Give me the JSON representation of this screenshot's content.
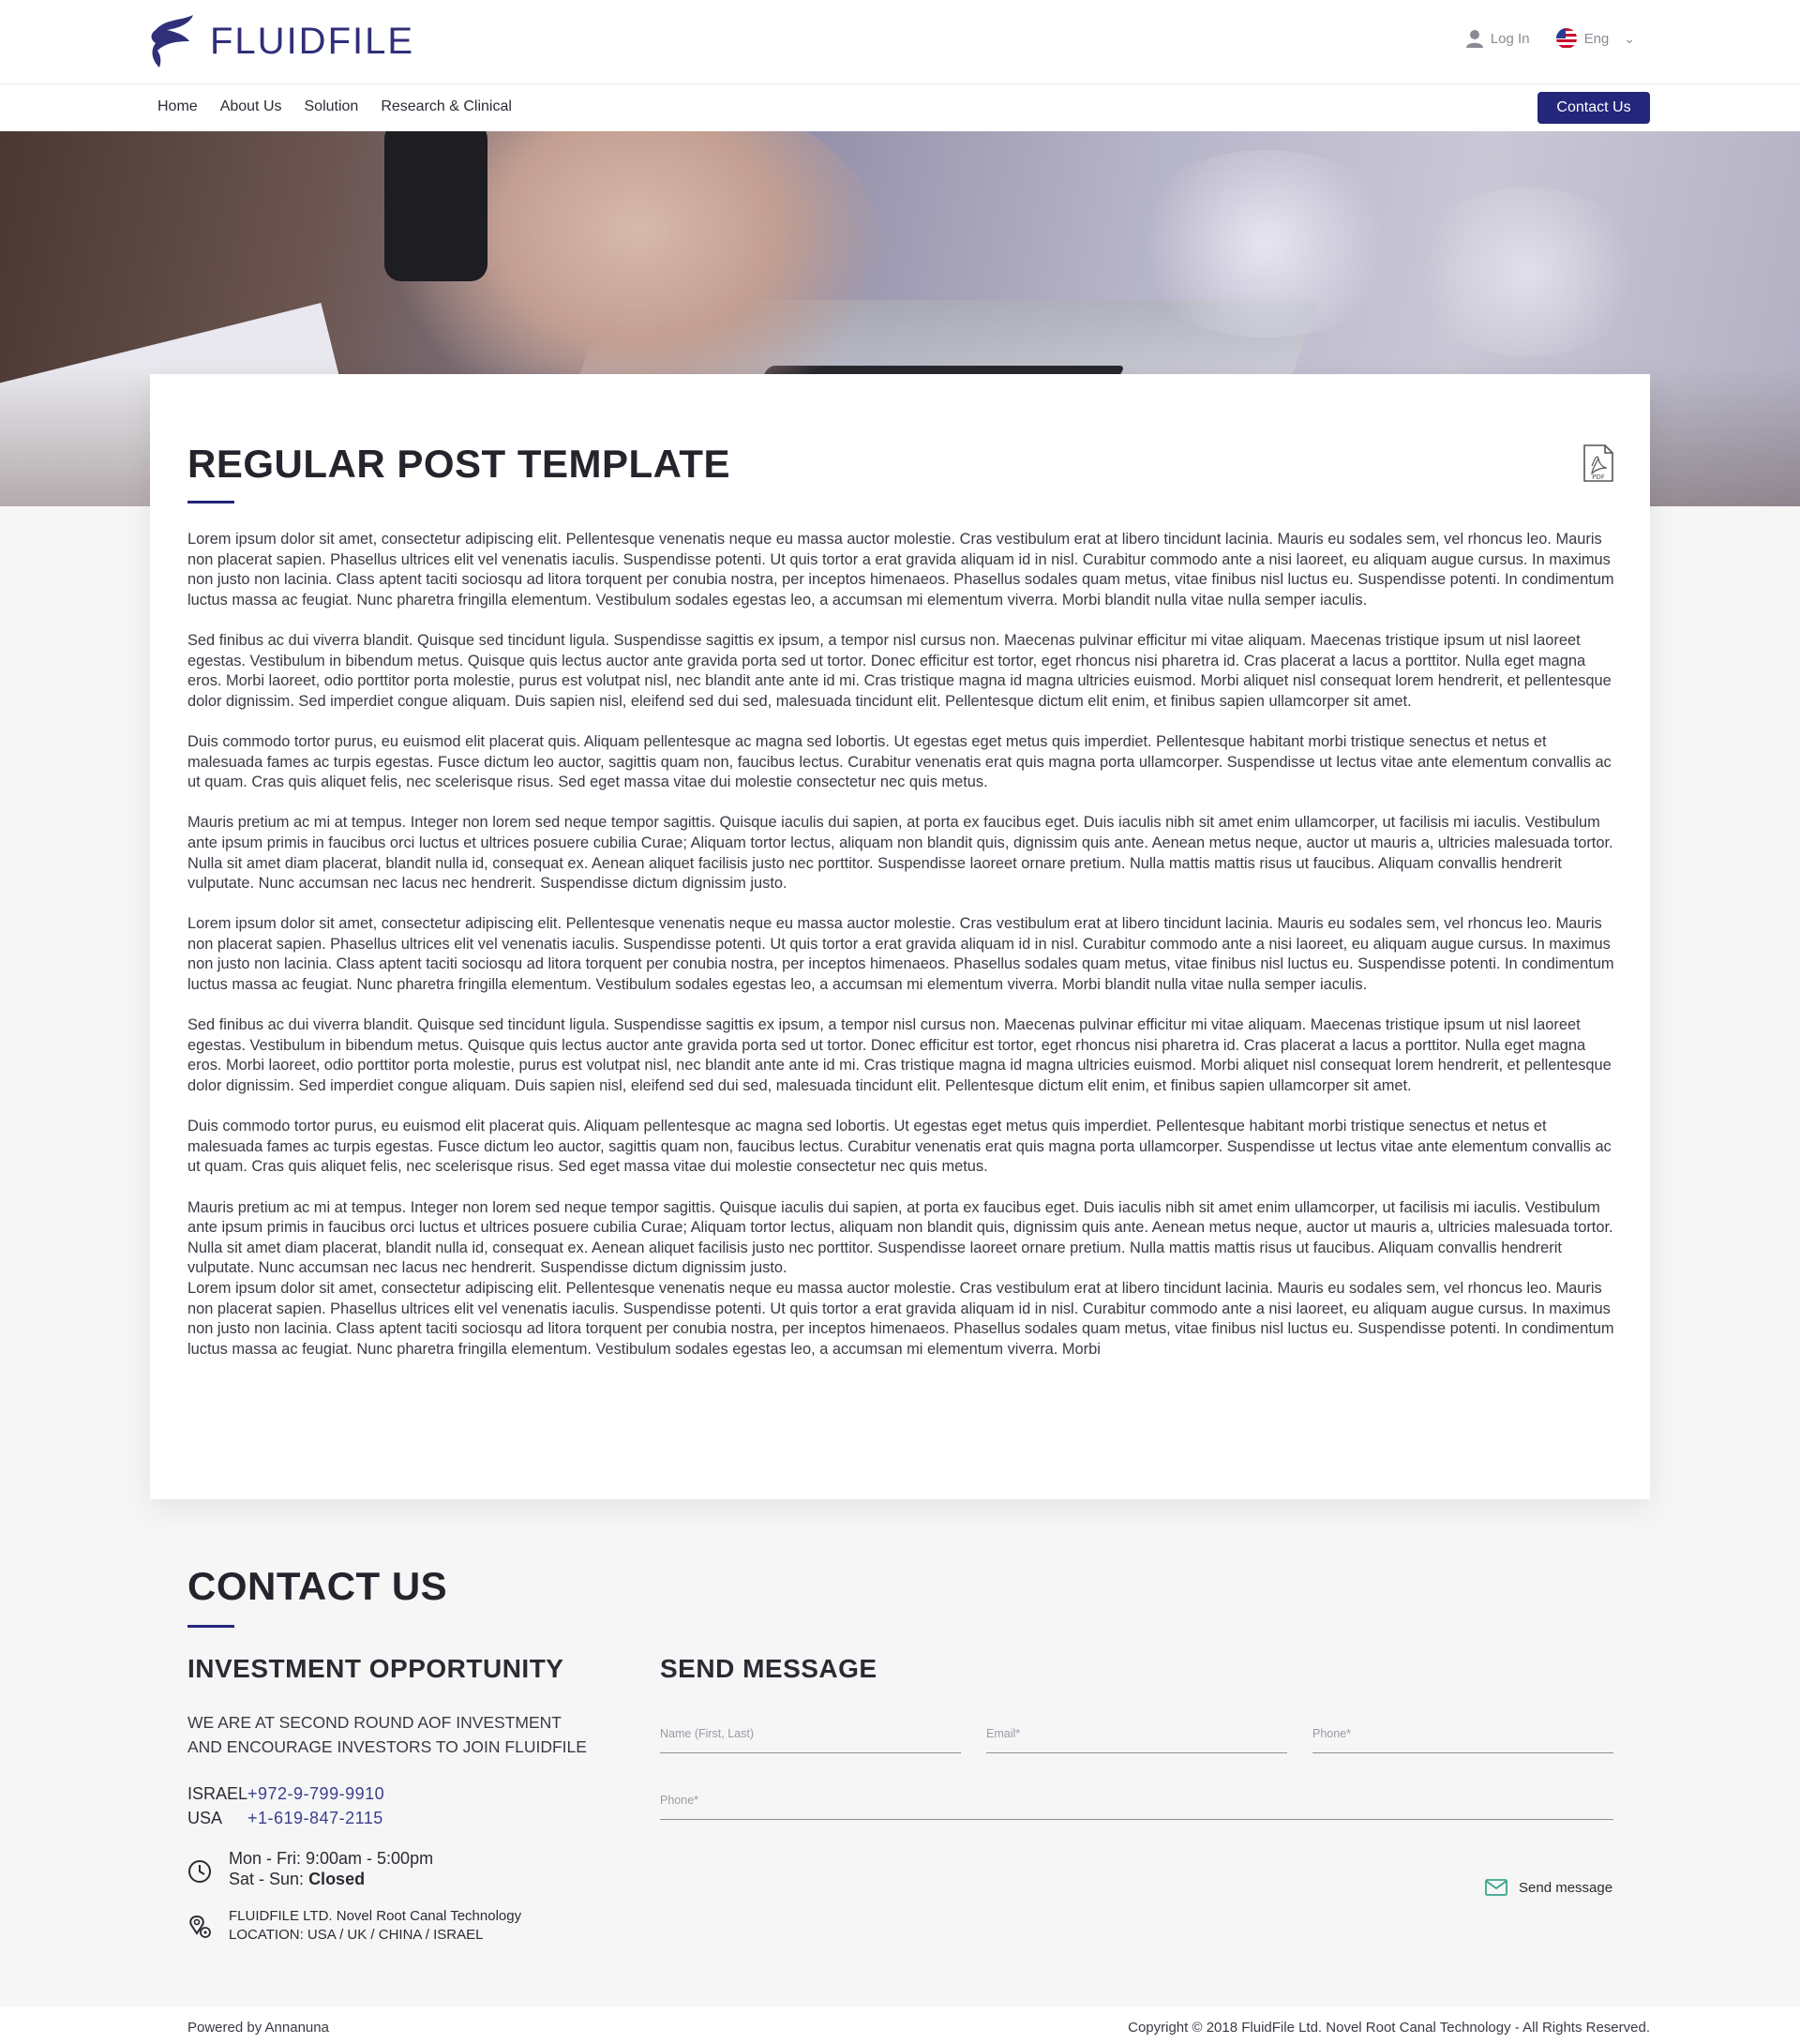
{
  "header": {
    "logo_text": "FLUIDFILE",
    "login_label": "Log In",
    "language_label": "Eng",
    "brand_color": "#23267a"
  },
  "nav": {
    "items": [
      "Home",
      "About Us",
      "Solution",
      "Research & Clinical"
    ],
    "contact_button": "Contact Us"
  },
  "post": {
    "title": "REGULAR POST TEMPLATE",
    "pdf_icon": "pdf-icon",
    "paragraphs": [
      "Lorem ipsum dolor sit amet, consectetur adipiscing elit. Pellentesque venenatis neque eu massa auctor molestie. Cras vestibulum erat at libero tincidunt lacinia. Mauris eu sodales sem, vel rhoncus leo. Mauris non placerat sapien. Phasellus ultrices elit vel venenatis iaculis. Suspendisse potenti. Ut quis tortor a erat gravida aliquam id in nisl. Curabitur commodo ante a nisi laoreet, eu aliquam augue cursus. In maximus non justo non lacinia. Class aptent taciti sociosqu ad litora torquent per conubia nostra, per inceptos himenaeos. Phasellus sodales quam metus, vitae finibus nisl luctus eu. Suspendisse potenti. In condimentum luctus massa ac feugiat. Nunc pharetra fringilla elementum. Vestibulum sodales egestas leo, a accumsan mi elementum viverra. Morbi blandit nulla vitae nulla semper iaculis.",
      "Sed finibus ac dui viverra blandit. Quisque sed tincidunt ligula. Suspendisse sagittis ex ipsum, a tempor nisl cursus non. Maecenas pulvinar efficitur mi vitae aliquam. Maecenas tristique ipsum ut nisl laoreet egestas. Vestibulum in bibendum metus. Quisque quis lectus auctor ante gravida porta sed ut tortor. Donec efficitur est tortor, eget rhoncus nisi pharetra id. Cras placerat a lacus a porttitor. Nulla eget magna eros. Morbi laoreet, odio porttitor porta molestie, purus est volutpat nisl, nec blandit ante ante id mi. Cras tristique magna id magna ultricies euismod. Morbi aliquet nisl consequat lorem hendrerit, et pellentesque dolor dignissim. Sed imperdiet congue aliquam. Duis sapien nisl, eleifend sed dui sed, malesuada tincidunt elit. Pellentesque dictum elit enim, et finibus sapien ullamcorper sit amet.",
      "Duis commodo tortor purus, eu euismod elit placerat quis. Aliquam pellentesque ac magna sed lobortis. Ut egestas eget metus quis imperdiet. Pellentesque habitant morbi tristique senectus et netus et malesuada fames ac turpis egestas. Fusce dictum leo auctor, sagittis quam non, faucibus lectus. Curabitur venenatis erat quis magna porta ullamcorper. Suspendisse ut lectus vitae ante elementum convallis ac ut quam. Cras quis aliquet felis, nec scelerisque risus. Sed eget massa vitae dui molestie consectetur nec quis metus.",
      "Mauris pretium ac mi at tempus. Integer non lorem sed neque tempor sagittis. Quisque iaculis dui sapien, at porta ex faucibus eget. Duis iaculis nibh sit amet enim ullamcorper, ut facilisis mi iaculis. Vestibulum ante ipsum primis in faucibus orci luctus et ultrices posuere cubilia Curae; Aliquam tortor lectus, aliquam non blandit quis, dignissim quis ante. Aenean metus neque, auctor ut mauris a, ultricies malesuada tortor. Nulla sit amet diam placerat, blandit nulla id, consequat ex. Aenean aliquet facilisis justo nec porttitor. Suspendisse laoreet ornare pretium. Nulla mattis mattis risus ut faucibus. Aliquam convallis hendrerit vulputate. Nunc accumsan nec lacus nec hendrerit. Suspendisse dictum dignissim justo.",
      "Lorem ipsum dolor sit amet, consectetur adipiscing elit. Pellentesque venenatis neque eu massa auctor molestie. Cras vestibulum erat at libero tincidunt lacinia. Mauris eu sodales sem, vel rhoncus leo. Mauris non placerat sapien. Phasellus ultrices elit vel venenatis iaculis. Suspendisse potenti. Ut quis tortor a erat gravida aliquam id in nisl. Curabitur commodo ante a nisi laoreet, eu aliquam augue cursus. In maximus non justo non lacinia. Class aptent taciti sociosqu ad litora torquent per conubia nostra, per inceptos himenaeos. Phasellus sodales quam metus, vitae finibus nisl luctus eu. Suspendisse potenti. In condimentum luctus massa ac feugiat. Nunc pharetra fringilla elementum. Vestibulum sodales egestas leo, a accumsan mi elementum viverra. Morbi blandit nulla vitae nulla semper iaculis.",
      "Sed finibus ac dui viverra blandit. Quisque sed tincidunt ligula. Suspendisse sagittis ex ipsum, a tempor nisl cursus non. Maecenas pulvinar efficitur mi vitae aliquam. Maecenas tristique ipsum ut nisl laoreet egestas. Vestibulum in bibendum metus. Quisque quis lectus auctor ante gravida porta sed ut tortor. Donec efficitur est tortor, eget rhoncus nisi pharetra id. Cras placerat a lacus a porttitor. Nulla eget magna eros. Morbi laoreet, odio porttitor porta molestie, purus est volutpat nisl, nec blandit ante ante id mi. Cras tristique magna id magna ultricies euismod. Morbi aliquet nisl consequat lorem hendrerit, et pellentesque dolor dignissim. Sed imperdiet congue aliquam. Duis sapien nisl, eleifend sed dui sed, malesuada tincidunt elit. Pellentesque dictum elit enim, et finibus sapien ullamcorper sit amet.",
      "Duis commodo tortor purus, eu euismod elit placerat quis. Aliquam pellentesque ac magna sed lobortis. Ut egestas eget metus quis imperdiet. Pellentesque habitant morbi tristique senectus et netus et malesuada fames ac turpis egestas. Fusce dictum leo auctor, sagittis quam non, faucibus lectus. Curabitur venenatis erat quis magna porta ullamcorper. Suspendisse ut lectus vitae ante elementum convallis ac ut quam. Cras quis aliquet felis, nec scelerisque risus. Sed eget massa vitae dui molestie consectetur nec quis metus.",
      "Mauris pretium ac mi at tempus. Integer non lorem sed neque tempor sagittis. Quisque iaculis dui sapien, at porta ex faucibus eget. Duis iaculis nibh sit amet enim ullamcorper, ut facilisis mi iaculis. Vestibulum ante ipsum primis in faucibus orci luctus et ultrices posuere cubilia Curae; Aliquam tortor lectus, aliquam non blandit quis, dignissim quis ante. Aenean metus neque, auctor ut mauris a, ultricies malesuada tortor. Nulla sit amet diam placerat, blandit nulla id, consequat ex. Aenean aliquet facilisis justo nec porttitor. Suspendisse laoreet ornare pretium. Nulla mattis mattis risus ut faucibus. Aliquam convallis hendrerit vulputate. Nunc accumsan nec lacus nec hendrerit. Suspendisse dictum dignissim justo.",
      "Lorem ipsum dolor sit amet, consectetur adipiscing elit. Pellentesque venenatis neque eu massa auctor molestie. Cras vestibulum erat at libero tincidunt lacinia. Mauris eu sodales sem, vel rhoncus leo. Mauris non placerat sapien. Phasellus ultrices elit vel venenatis iaculis. Suspendisse potenti. Ut quis tortor a erat gravida aliquam id in nisl. Curabitur commodo ante a nisi laoreet, eu aliquam augue cursus. In maximus non justo non lacinia. Class aptent taciti sociosqu ad litora torquent per conubia nostra, per inceptos himenaeos. Phasellus sodales quam metus, vitae finibus nisl luctus eu. Suspendisse potenti. In condimentum luctus massa ac feugiat. Nunc pharetra fringilla elementum. Vestibulum sodales egestas leo, a accumsan mi elementum viverra. Morbi"
    ]
  },
  "contact": {
    "title": "CONTACT US",
    "investment_title": "INVESTMENT OPPORTUNITY",
    "investment_text_line1": "WE ARE AT SECOND ROUND AOF INVESTMENT",
    "investment_text_line2": "AND ENCOURAGE INVESTORS TO JOIN FLUIDFILE",
    "phones": [
      {
        "country": "ISRAEL",
        "number": "+972-9-799-9910"
      },
      {
        "country": "USA",
        "number": "+1-619-847-2115"
      }
    ],
    "hours_weekday": "Mon -  Fri: 9:00am  -  5:00pm",
    "hours_weekend_label": "Sat  -  Sun:",
    "hours_weekend_value": "Closed",
    "address_line1": "FLUIDFILE LTD. Novel Root Canal Technology",
    "address_line2": "LOCATION: USA / UK / CHINA / ISRAEL",
    "form": {
      "title": "SEND MESSAGE",
      "name_placeholder": "Name (First, Last)",
      "email_placeholder": "Email*",
      "phone_placeholder": "Phone*",
      "phone2_placeholder": "Phone*",
      "send_label": "Send message"
    }
  },
  "footer": {
    "powered_by": "Powered by Annanuna",
    "copyright": "Copyright © 2018 FluidFile Ltd. Novel Root Canal Technology - All Rights Reserved."
  }
}
